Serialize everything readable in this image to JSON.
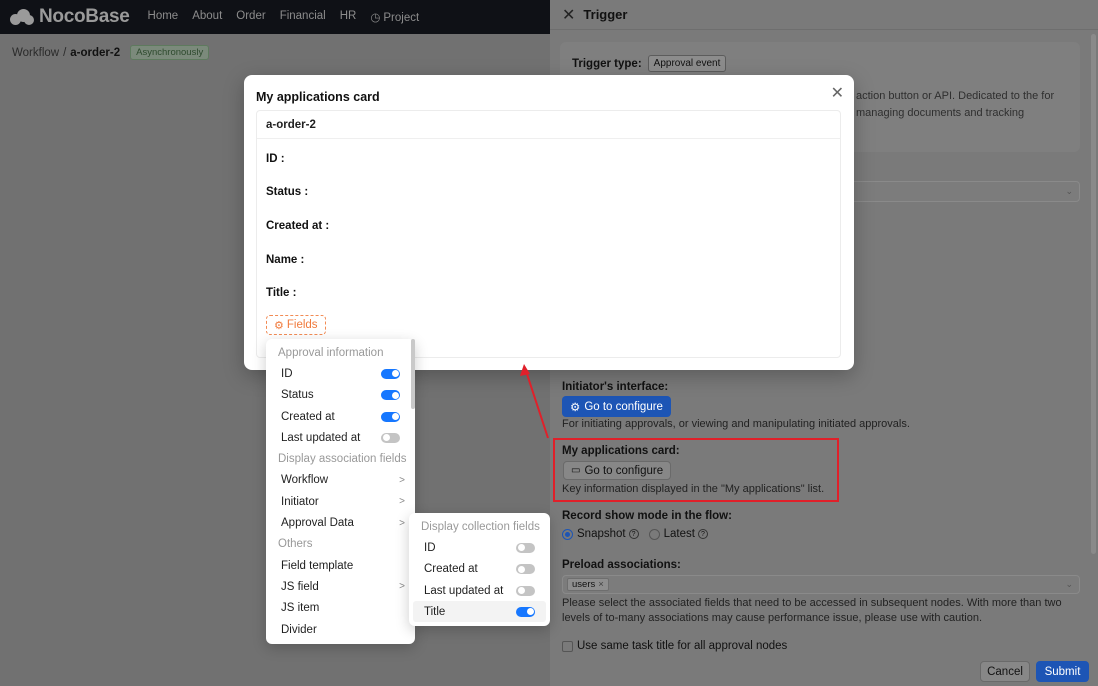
{
  "app": {
    "logo_text": "NocoBase",
    "nav": [
      "Home",
      "About",
      "Order",
      "Financial",
      "HR",
      "Project"
    ]
  },
  "breadcrumb": {
    "parent": "Workflow",
    "sep": "/",
    "current": "a-order-2",
    "mode_tag": "Asynchronously"
  },
  "drawer": {
    "title": "Trigger",
    "trigger_type_label": "Trigger type:",
    "trigger_type_value": "Approval event",
    "trigger_desc": "action button or API. Dedicated to the for managing documents and tracking",
    "initiator_label": "Initiator's interface:",
    "initiator_btn": "Go to configure",
    "initiator_help": "For initiating approvals, or viewing and manipulating initiated approvals.",
    "apps_card_label": "My applications card:",
    "apps_card_btn": "Go to configure",
    "apps_card_help": "Key information displayed in the \"My applications\" list.",
    "record_mode_label": "Record show mode in the flow:",
    "record_mode_snapshot": "Snapshot",
    "record_mode_latest": "Latest",
    "preload_label": "Preload associations:",
    "preload_chip": "users",
    "preload_help": "Please select the associated fields that need to be accessed in subsequent nodes. With more than two levels of to-many associations may cause performance issue, please use with caution.",
    "same_title_label": "Use same task title for all approval nodes",
    "cancel": "Cancel",
    "submit": "Submit"
  },
  "modal": {
    "title": "My applications card",
    "card_title": "a-order-2",
    "fields": [
      "ID :",
      "Status :",
      "Created at :",
      "Name :",
      "Title :"
    ],
    "fields_button": "Fields"
  },
  "menu1": {
    "group_approval": "Approval information",
    "approval_items": [
      {
        "label": "ID",
        "on": true
      },
      {
        "label": "Status",
        "on": true
      },
      {
        "label": "Created at",
        "on": true
      },
      {
        "label": "Last updated at",
        "on": false
      }
    ],
    "group_assoc": "Display association fields",
    "assoc_items": [
      "Workflow",
      "Initiator",
      "Approval Data"
    ],
    "group_others": "Others",
    "other_items": [
      "Field template",
      "JS field",
      "JS item",
      "Divider"
    ]
  },
  "menu2": {
    "group": "Display collection fields",
    "items": [
      {
        "label": "ID",
        "on": false
      },
      {
        "label": "Created at",
        "on": false
      },
      {
        "label": "Last updated at",
        "on": false
      },
      {
        "label": "Title",
        "on": true
      }
    ]
  },
  "colors": {
    "primary": "#1677ff",
    "highlight": "#e0202a",
    "fields_accent": "#f07a3c"
  }
}
